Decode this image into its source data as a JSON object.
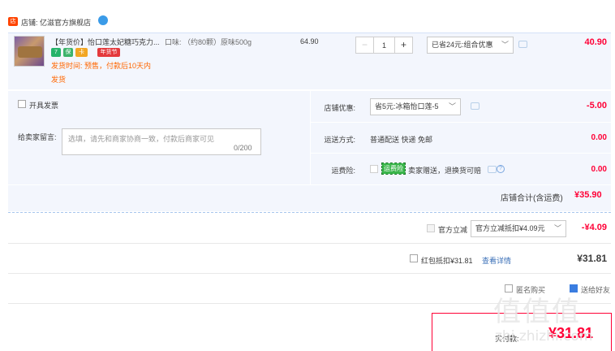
{
  "shop": {
    "icon_text": "店",
    "label": "店铺: 亿滋官方旗舰店",
    "ww_icon": "wangwang-chat-icon"
  },
  "item": {
    "title": "【年货价】怡口莲太妃糖巧克力...",
    "sku": "口味: （约80颗）原味500g",
    "badges": [
      "7",
      "保",
      "卡",
      "年货节"
    ],
    "ship_time": "发货时间: 预售，付款后10天内",
    "ship_word": "发货",
    "unit_price": "64.90",
    "qty": "1",
    "qty_minus": "−",
    "qty_plus": "+",
    "promo_select": "已省24元:组合优惠",
    "total": "40.90"
  },
  "order": {
    "invoice_label": "开具发票",
    "memo_label": "给卖家留言:",
    "memo_placeholder": "选填，请先和商家协商一致，付款后商家可见",
    "memo_count": "0/200",
    "shop_discount_label": "店铺优惠:",
    "shop_discount_select": "省5元:冰箱怡口莲-5",
    "shop_discount_amount": "-5.00",
    "ship_label": "运送方式:",
    "ship_method": "普通配送 快递 免邮",
    "ship_amount": "0.00",
    "ins_label": "运费险:",
    "ins_tag": "运费险",
    "ins_text": "卖家赠送，退换货可赔",
    "ins_amount": "0.00",
    "help_icon": "?",
    "subtotal_label": "店铺合计(含运费)",
    "subtotal_amount": "¥35.90"
  },
  "platform": {
    "official_label": "官方立减",
    "official_select": "官方立减抵扣¥4.09元",
    "official_amount": "-¥4.09",
    "hb_label": "红包抵扣¥31.81",
    "hb_link": "查看详情",
    "hb_amount": "¥31.81",
    "anon_label": "匿名购买",
    "gift_label": "送给好友"
  },
  "pay": {
    "label": "实付款:",
    "amount": "¥31.81"
  },
  "watermark": {
    "glyphs": "值值值",
    "text": "zhi.zhizhi.com"
  },
  "colors": {
    "price_red": "#ff0036",
    "panel_bg": "#f3f6fd",
    "link_blue": "#3a6fb7",
    "orange": "#ff6600"
  }
}
